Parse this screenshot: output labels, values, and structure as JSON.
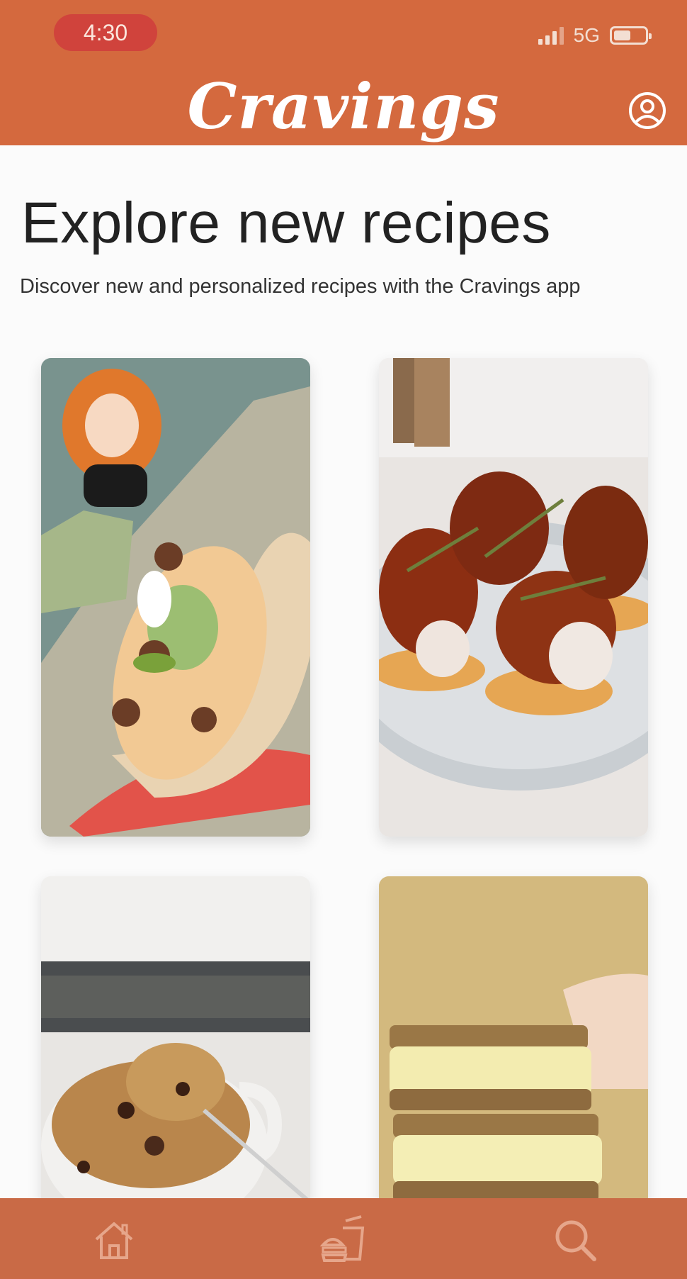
{
  "status_bar": {
    "time": "4:30",
    "network": "5G",
    "battery_level": 0.55
  },
  "header": {
    "app_title": "Cravings",
    "profile_icon": "user-circle-icon"
  },
  "main": {
    "title": "Explore new recipes",
    "subtitle": "Discover new and personalized recipes with the Cravings app"
  },
  "recipes": [
    {
      "image": "taco-with-cartoon-photo"
    },
    {
      "image": "cheese-bites-with-jam-photo"
    },
    {
      "image": "mug-cookie-photo"
    },
    {
      "image": "egg-sandwich-photo"
    }
  ],
  "bottom_nav": [
    {
      "icon": "home-icon"
    },
    {
      "icon": "fast-food-icon"
    },
    {
      "icon": "search-icon"
    }
  ],
  "colors": {
    "brand": "#d4693e",
    "nav": "#c96a46",
    "time_pill": "#d0433c"
  }
}
